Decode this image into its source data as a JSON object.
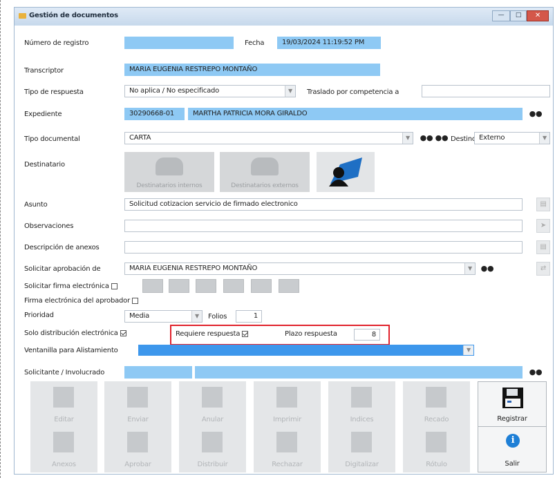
{
  "window": {
    "title": "Gestión de documentos",
    "icon": "folder-icon"
  },
  "labels": {
    "numero_registro": "Número de registro",
    "fecha": "Fecha",
    "transcriptor": "Transcriptor",
    "tipo_respuesta": "Tipo de respuesta",
    "traslado": "Traslado por competencia a",
    "expediente": "Expediente",
    "tipo_documental": "Tipo documental",
    "destino": "Destino",
    "destinatario": "Destinatario",
    "asunto": "Asunto",
    "observaciones": "Observaciones",
    "descripcion_anexos": "Descripción de anexos",
    "solicitar_aprobacion": "Solicitar aprobación de",
    "solicitar_firma": "Solicitar firma electrónica",
    "firma_aprobador": "Firma electrónica del aprobador",
    "prioridad": "Prioridad",
    "folios": "Folios",
    "solo_distribucion": "Solo distribución electrónica",
    "requiere_respuesta": "Requiere respuesta",
    "plazo_respuesta": "Plazo respuesta",
    "ventanilla": "Ventanilla para Alistamiento",
    "solicitante": "Solicitante / Involucrado"
  },
  "values": {
    "numero_registro": "",
    "fecha": "19/03/2024 11:19:52 PM",
    "transcriptor": "MARIA EUGENIA RESTREPO MONTAÑO",
    "tipo_respuesta": "No aplica / No especificado",
    "traslado": "",
    "expediente_code": "30290668-01",
    "expediente_name": "MARTHA PATRICIA MORA GIRALDO",
    "tipo_documental": "CARTA",
    "destino": "Externo",
    "asunto": "Solicitud cotizacion servicio de firmado electronico",
    "observaciones": "",
    "descripcion_anexos": "",
    "solicitar_aprobacion": "MARIA EUGENIA RESTREPO MONTAÑO",
    "prioridad": "Media",
    "folios": "1",
    "plazo_respuesta": "8",
    "ventanilla": "",
    "solicitante": ""
  },
  "checks": {
    "solicitar_firma": false,
    "firma_aprobador": false,
    "solo_distribucion": true,
    "requiere_respuesta": true
  },
  "destinatario_buttons": {
    "internos": "Destinatarios internos",
    "externos": "Destinatarios externos"
  },
  "action_buttons_row1": [
    "Editar",
    "Enviar",
    "Anular",
    "Imprimir",
    "Indices",
    "Recado",
    "Registrar"
  ],
  "action_buttons_row2": [
    "Anexos",
    "Aprobar",
    "Distribuir",
    "Rechazar",
    "Digitalizar",
    "Rótulo",
    "Salir"
  ],
  "highlight_color": "#e0202a",
  "accent_color": "#8ec9f4"
}
